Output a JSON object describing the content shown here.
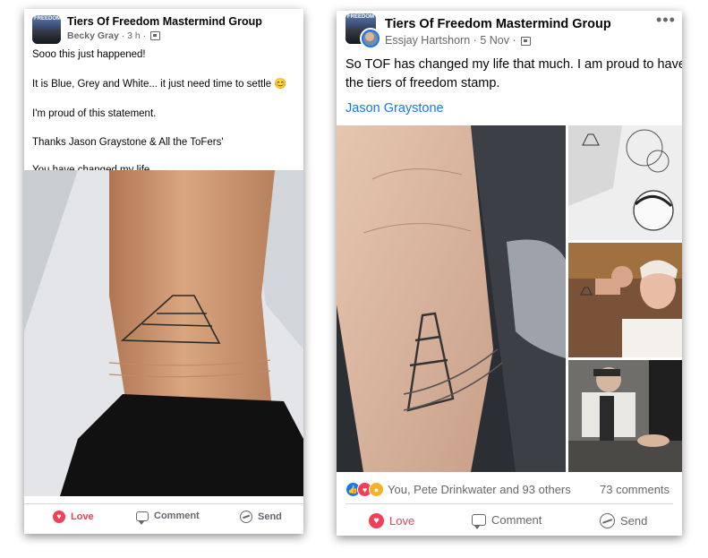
{
  "post1": {
    "group_name": "Tiers Of Freedom Mastermind Group",
    "author": "Becky Gray",
    "time": "3 h",
    "separator": "·",
    "avatar_logo": "FREEDOM",
    "body": [
      "Sooo this just happened!",
      "It is Blue, Grey and White... it just need time to settle 😊",
      "I'm proud of this statement.",
      "Thanks Jason Graystone & All the ToFers'",
      "You have changed my life"
    ],
    "actions": {
      "love": "Love",
      "comment": "Comment",
      "send": "Send"
    }
  },
  "post2": {
    "group_name": "Tiers Of Freedom Mastermind Group",
    "author": "Essjay Hartshorn",
    "time": "5 Nov",
    "separator": "·",
    "avatar_logo": "FREEDOM",
    "more": "•••",
    "body_line1": "So TOF has changed my life that much. I am proud to have",
    "body_line2": "the tiers of freedom stamp.",
    "mention": "Jason Graystone",
    "reactions_text": "You, Pete Drinkwater and 93 others",
    "comments": "73 comments",
    "actions": {
      "love": "Love",
      "comment": "Comment",
      "send": "Send"
    }
  },
  "colors": {
    "love": "#f33e58",
    "like": "#1877f2",
    "link": "#1877f2",
    "muted": "#65676b"
  },
  "icons": [
    "heart-icon",
    "comment-icon",
    "messenger-send-icon",
    "globe-icon",
    "more-icon"
  ]
}
